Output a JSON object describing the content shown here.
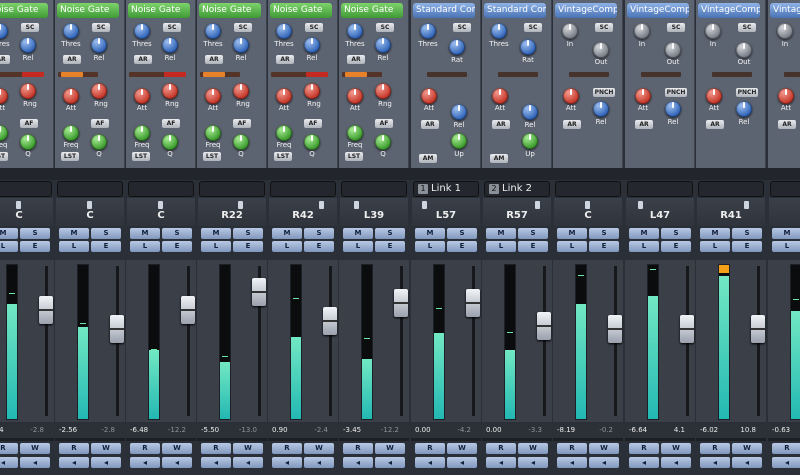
{
  "knob_labels": {
    "thres": "Thres",
    "rel": "Rel",
    "att": "Att",
    "rng": "Rng",
    "freq": "Freq",
    "q": "Q",
    "in": "In",
    "out": "Out",
    "rat": "Rat",
    "up": "Up"
  },
  "button_labels": {
    "sc": "SC",
    "ar": "AR",
    "af": "AF",
    "lst": "LST",
    "am": "AM",
    "pnch": "PNCH",
    "mute": "M",
    "solo": "S",
    "listen": "L",
    "edit": "E",
    "read": "R",
    "write": "W"
  },
  "channels": [
    {
      "plugin": "Noise Gate",
      "type": "gate",
      "link": "",
      "pan": "C",
      "vol": "0.04",
      "peak": "-2.8",
      "peak_hot": false,
      "pan_pos": 0.5,
      "meter": 0.75,
      "peak_mark": 0.84,
      "fader": 0.72,
      "clip": false
    },
    {
      "plugin": "Noise Gate",
      "type": "gate",
      "link": "",
      "pan": "C",
      "vol": "-2.56",
      "peak": "-2.8",
      "peak_hot": false,
      "pan_pos": 0.5,
      "meter": 0.6,
      "peak_mark": 0.64,
      "fader": 0.58,
      "clip": false
    },
    {
      "plugin": "Noise Gate",
      "type": "gate",
      "link": "",
      "pan": "C",
      "vol": "-6.48",
      "peak": "-12.2",
      "peak_hot": false,
      "pan_pos": 0.5,
      "meter": 0.45,
      "peak_mark": 0.47,
      "fader": 0.72,
      "clip": false
    },
    {
      "plugin": "Noise Gate",
      "type": "gate",
      "link": "",
      "pan": "R22",
      "vol": "-5.50",
      "peak": "-13.0",
      "peak_hot": false,
      "pan_pos": 0.65,
      "meter": 0.37,
      "peak_mark": 0.42,
      "fader": 0.86,
      "clip": false
    },
    {
      "plugin": "Noise Gate",
      "type": "gate",
      "link": "",
      "pan": "R42",
      "vol": "0.90",
      "peak": "-2.4",
      "peak_hot": false,
      "pan_pos": 0.8,
      "meter": 0.53,
      "peak_mark": 0.81,
      "fader": 0.64,
      "clip": false
    },
    {
      "plugin": "Noise Gate",
      "type": "gate",
      "link": "",
      "pan": "L39",
      "vol": "-3.45",
      "peak": "-12.2",
      "peak_hot": false,
      "pan_pos": 0.23,
      "meter": 0.39,
      "peak_mark": 0.54,
      "fader": 0.78,
      "clip": false
    },
    {
      "plugin": "Standard Comp",
      "type": "std",
      "link": "Link 1",
      "link_num": "1",
      "pan": "L57",
      "vol": "0.00",
      "peak": "-4.2",
      "peak_hot": false,
      "pan_pos": 0.16,
      "meter": 0.56,
      "peak_mark": 0.74,
      "fader": 0.78,
      "clip": false
    },
    {
      "plugin": "Standard Comp",
      "type": "std",
      "link": "Link 2",
      "link_num": "2",
      "pan": "R57",
      "vol": "0.00",
      "peak": "-3.3",
      "peak_hot": false,
      "pan_pos": 0.84,
      "meter": 0.45,
      "peak_mark": 0.58,
      "fader": 0.6,
      "clip": false
    },
    {
      "plugin": "VintageComp",
      "type": "vint",
      "link": "",
      "pan": "C",
      "vol": "-8.19",
      "peak": "-0.2",
      "peak_hot": false,
      "pan_pos": 0.5,
      "meter": 0.75,
      "peak_mark": 0.96,
      "fader": 0.58,
      "clip": false
    },
    {
      "plugin": "VintageComp",
      "type": "vint",
      "link": "",
      "pan": "L47",
      "vol": "-6.64",
      "peak": "4.1",
      "peak_hot": true,
      "pan_pos": 0.2,
      "meter": 0.8,
      "peak_mark": 1.0,
      "fader": 0.58,
      "clip": false
    },
    {
      "plugin": "VintageComp",
      "type": "vint",
      "link": "",
      "pan": "R41",
      "vol": "-6.02",
      "peak": "10.8",
      "peak_hot": true,
      "pan_pos": 0.76,
      "meter": 0.93,
      "peak_mark": 1.0,
      "fader": 0.58,
      "clip": true
    },
    {
      "plugin": "VintageComp",
      "type": "vint",
      "link": "",
      "pan": "",
      "vol": "-0.63",
      "peak": "",
      "peak_hot": false,
      "pan_pos": 0.5,
      "meter": 0.7,
      "peak_mark": 0.8,
      "fader": 0.75,
      "clip": false
    }
  ]
}
